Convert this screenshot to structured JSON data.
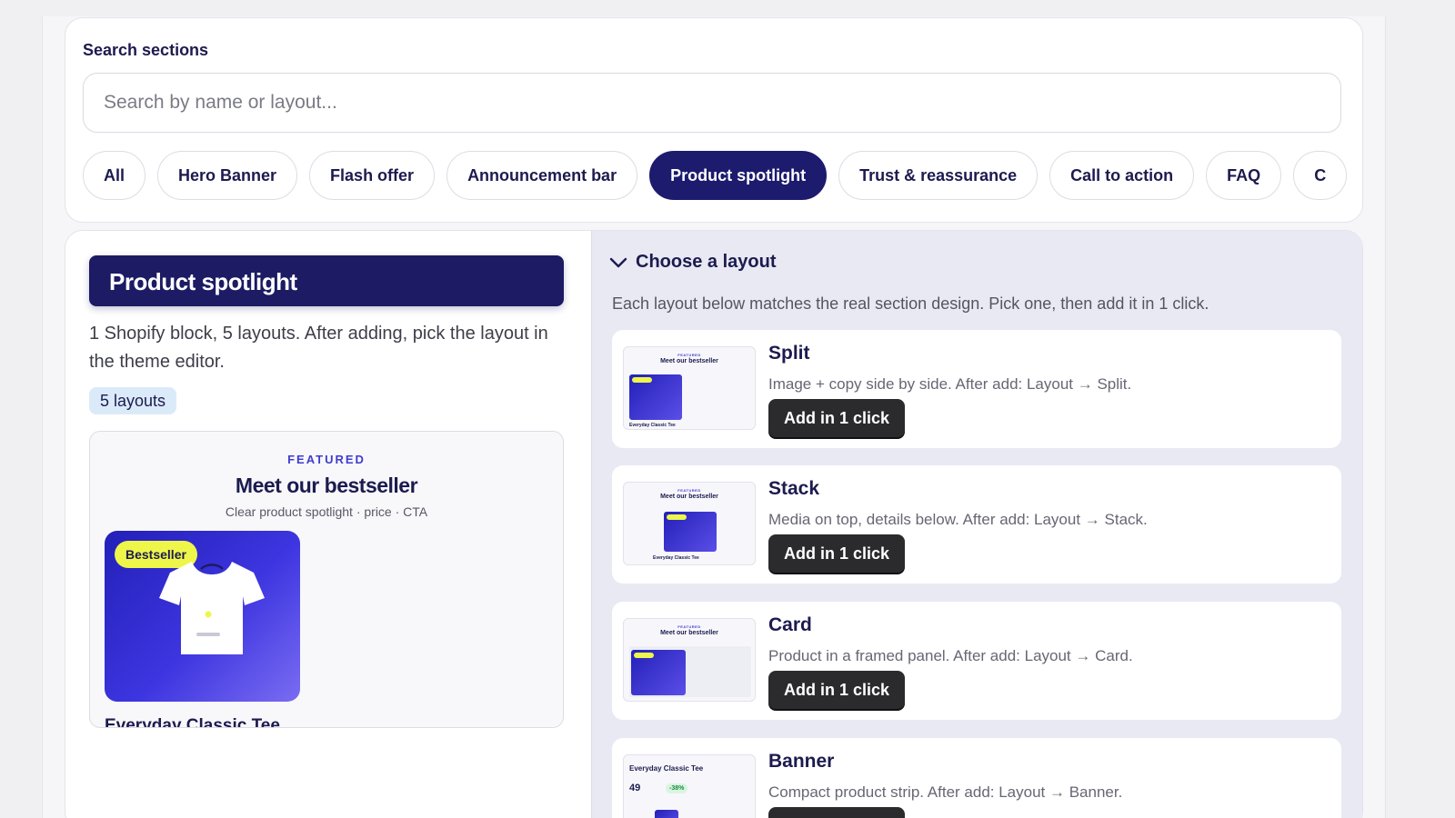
{
  "search": {
    "heading": "Search sections",
    "placeholder": "Search by name or layout..."
  },
  "filters": [
    {
      "label": "All",
      "active": false
    },
    {
      "label": "Hero Banner",
      "active": false
    },
    {
      "label": "Flash offer",
      "active": false
    },
    {
      "label": "Announcement bar",
      "active": false
    },
    {
      "label": "Product spotlight",
      "active": true
    },
    {
      "label": "Trust & reassurance",
      "active": false
    },
    {
      "label": "Call to action",
      "active": false
    },
    {
      "label": "FAQ",
      "active": false
    },
    {
      "label": "C",
      "active": false
    }
  ],
  "section": {
    "title": "Product spotlight",
    "description": "1 Shopify block, 5 layouts. After adding, pick the layout in the theme editor.",
    "badge": "5 layouts",
    "preview": {
      "eyebrow": "FEATURED",
      "headline": "Meet our bestseller",
      "subline": "Clear product spotlight · price · CTA",
      "badge": "Bestseller",
      "product": "Everyday Classic Tee"
    }
  },
  "layouts_panel": {
    "heading": "Choose a layout",
    "description": "Each layout below matches the real section design. Pick one, then add it in 1 click.",
    "add_label": "Add in 1 click",
    "items": [
      {
        "name": "Split",
        "description": "Image + copy side by side. After add: Layout → Split."
      },
      {
        "name": "Stack",
        "description": "Media on top, details below. After add: Layout → Stack."
      },
      {
        "name": "Card",
        "description": "Product in a framed panel. After add: Layout → Card."
      },
      {
        "name": "Banner",
        "description": "Compact product strip. After add: Layout → Banner."
      }
    ],
    "thumb": {
      "eyebrow": "FEATURED",
      "headline": "Meet our bestseller",
      "product": "Everyday Classic Tee",
      "price": "49",
      "discount": "-38%"
    }
  },
  "colors": {
    "navy": "#1c1b64",
    "accent": "#3f3ccf",
    "badge_yellow": "#eef64a",
    "dark_button": "#2b2b2e"
  }
}
